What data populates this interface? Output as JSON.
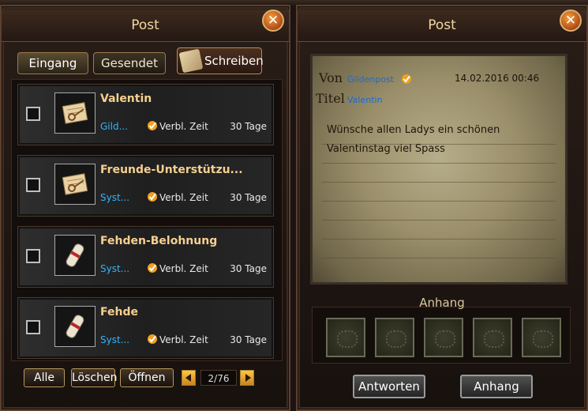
{
  "left_panel": {
    "title": "Post",
    "close_symbol": "✕",
    "tabs": [
      {
        "label": "Eingang",
        "active": true
      },
      {
        "label": "Gesendet",
        "active": false
      }
    ],
    "write_button": "Schreiben",
    "items": [
      {
        "title": "Valentin",
        "sender": "Gild...",
        "time_label": "Verbl. Zeit",
        "days": "30 Tage",
        "icon": "letter-key-icon"
      },
      {
        "title": "Freunde-Unterstützu...",
        "sender": "Syst...",
        "time_label": "Verbl. Zeit",
        "days": "30 Tage",
        "icon": "letter-key-icon"
      },
      {
        "title": "Fehden-Belohnung",
        "sender": "Syst...",
        "time_label": "Verbl. Zeit",
        "days": "30 Tage",
        "icon": "scroll-icon"
      },
      {
        "title": "Fehde",
        "sender": "Syst...",
        "time_label": "Verbl. Zeit",
        "days": "30 Tage",
        "icon": "scroll-icon"
      }
    ],
    "buttons": {
      "all": "Alle",
      "delete": "Löschen",
      "open": "Öffnen"
    },
    "pagination": "2/76"
  },
  "right_panel": {
    "title": "Post",
    "close_symbol": "✕",
    "from_label": "Von",
    "from_value": "Gildenpost",
    "date": "14.02.2016 00:46",
    "title_label": "Titel",
    "title_value": "Valentin",
    "message_lines": [
      "Wünsche allen Ladys ein schönen",
      "Valentinstag viel Spass"
    ],
    "attachment_title": "Anhang",
    "attachment_slots": 5,
    "reply_button": "Antworten",
    "attach_button": "Anhang"
  },
  "colors": {
    "accent": "#f7d090",
    "link": "#2fb5ff",
    "check": "#f0a020"
  }
}
